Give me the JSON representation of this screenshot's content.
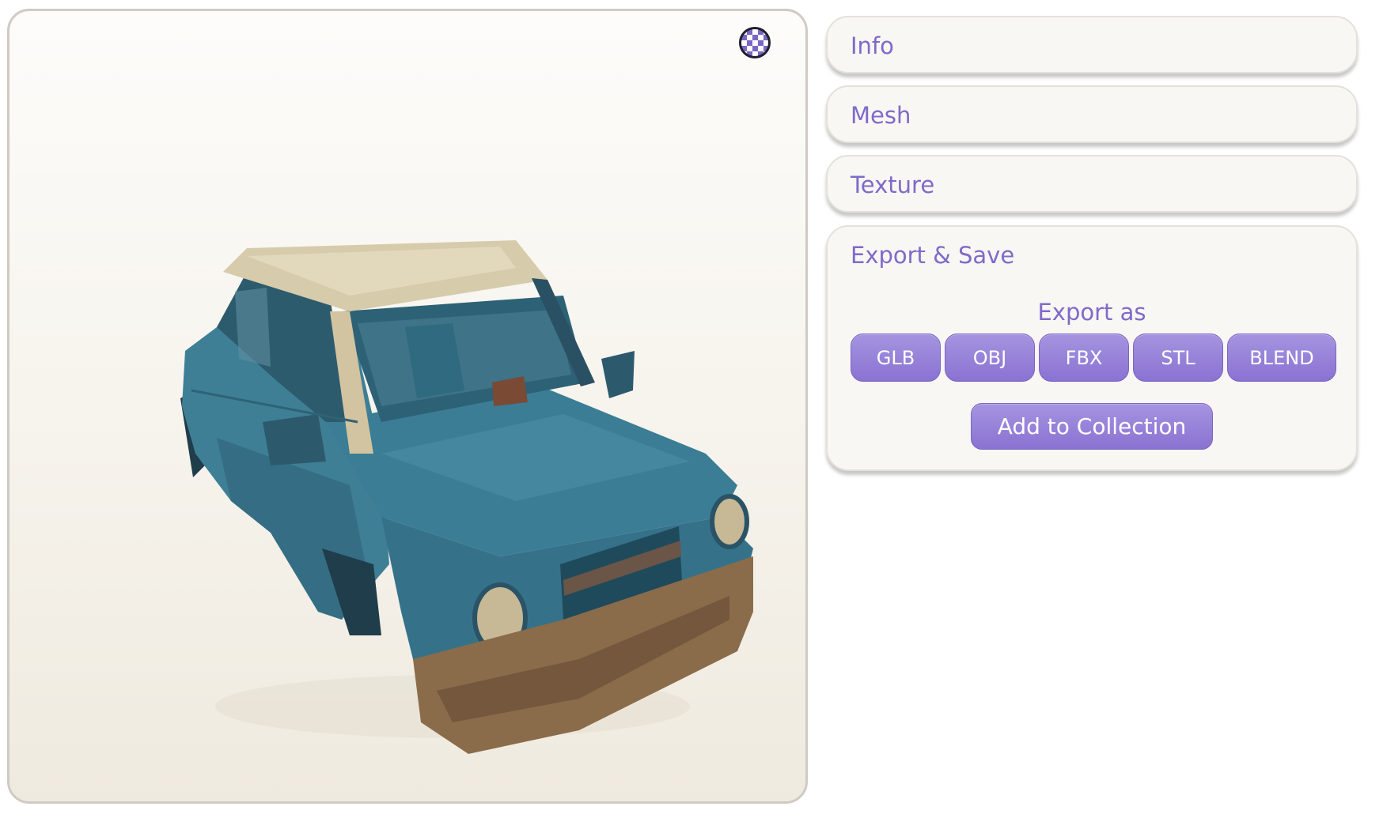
{
  "viewer": {
    "background_toggle_icon": "checkerboard-icon",
    "model": "car"
  },
  "panels": {
    "info": {
      "title": "Info"
    },
    "mesh": {
      "title": "Mesh"
    },
    "texture": {
      "title": "Texture"
    },
    "export": {
      "title": "Export & Save",
      "export_label": "Export as",
      "formats": [
        "GLB",
        "OBJ",
        "FBX",
        "STL",
        "BLEND"
      ],
      "add_to_collection_label": "Add to Collection"
    }
  },
  "colors": {
    "accent": "#7f6ac9",
    "button": "#9783d9",
    "panel_bg": "#f8f7f3"
  }
}
